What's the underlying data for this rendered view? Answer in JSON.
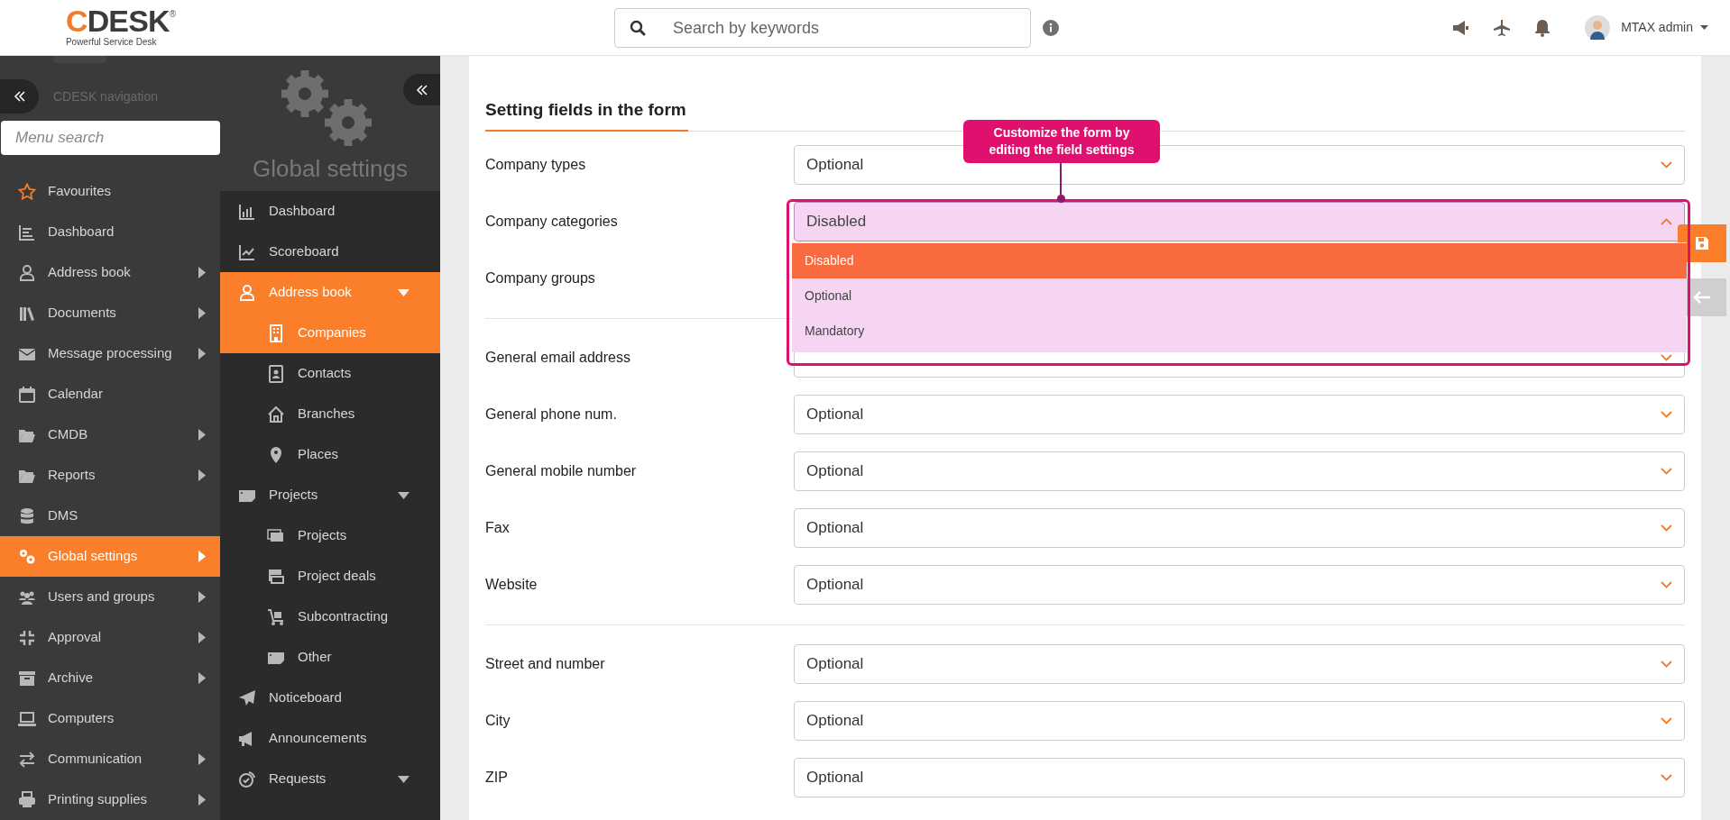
{
  "header": {
    "logo": {
      "name": "CDESK",
      "registered": "®",
      "tagline": "Powerful Service Desk"
    },
    "search": {
      "placeholder": "Search by keywords"
    },
    "user_name": "MTAX admin"
  },
  "navigation": {
    "title": "CDESK navigation",
    "search_placeholder": "Menu search",
    "items": [
      {
        "label": "Favourites",
        "has_submenu": false,
        "selected": false
      },
      {
        "label": "Dashboard",
        "has_submenu": false,
        "selected": false
      },
      {
        "label": "Address book",
        "has_submenu": true,
        "selected": false
      },
      {
        "label": "Documents",
        "has_submenu": true,
        "selected": false
      },
      {
        "label": "Message processing",
        "has_submenu": true,
        "selected": false
      },
      {
        "label": "Calendar",
        "has_submenu": false,
        "selected": false
      },
      {
        "label": "CMDB",
        "has_submenu": true,
        "selected": false
      },
      {
        "label": "Reports",
        "has_submenu": true,
        "selected": false
      },
      {
        "label": "DMS",
        "has_submenu": false,
        "selected": false
      },
      {
        "label": "Global settings",
        "has_submenu": true,
        "selected": true
      },
      {
        "label": "Users and groups",
        "has_submenu": true,
        "selected": false
      },
      {
        "label": "Approval",
        "has_submenu": true,
        "selected": false
      },
      {
        "label": "Archive",
        "has_submenu": true,
        "selected": false
      },
      {
        "label": "Computers",
        "has_submenu": false,
        "selected": false
      },
      {
        "label": "Communication",
        "has_submenu": true,
        "selected": false
      },
      {
        "label": "Printing supplies",
        "has_submenu": true,
        "selected": false
      }
    ]
  },
  "settings_panel": {
    "title": "Global settings",
    "items": [
      {
        "label": "Dashboard",
        "selected": false
      },
      {
        "label": "Scoreboard",
        "selected": false
      },
      {
        "label": "Address book",
        "selected": true,
        "expanded": true,
        "children": [
          {
            "label": "Companies",
            "selected": true
          },
          {
            "label": "Contacts",
            "selected": false
          },
          {
            "label": "Branches",
            "selected": false
          },
          {
            "label": "Places",
            "selected": false
          }
        ]
      },
      {
        "label": "Projects",
        "selected": false,
        "expanded": true,
        "children": [
          {
            "label": "Projects",
            "selected": false
          },
          {
            "label": "Project deals",
            "selected": false
          },
          {
            "label": "Subcontracting",
            "selected": false
          },
          {
            "label": "Other",
            "selected": false
          }
        ]
      },
      {
        "label": "Noticeboard",
        "selected": false
      },
      {
        "label": "Announcements",
        "selected": false
      },
      {
        "label": "Requests",
        "selected": false,
        "expanded": true
      }
    ]
  },
  "form": {
    "title": "Setting fields in the form",
    "groups": [
      [
        {
          "label": "Company types",
          "kind": "select",
          "value": "Optional"
        },
        {
          "label": "Company categories",
          "kind": "select",
          "value": "Disabled",
          "open": true,
          "options": [
            {
              "label": "Disabled",
              "selected": true
            },
            {
              "label": "Optional",
              "selected": false
            },
            {
              "label": "Mandatory",
              "selected": false
            }
          ]
        },
        {
          "label": "Company groups",
          "kind": "label_only"
        }
      ],
      [
        {
          "label": "General email address",
          "kind": "select"
        },
        {
          "label": "General phone num.",
          "kind": "select",
          "value": "Optional"
        },
        {
          "label": "General mobile number",
          "kind": "select",
          "value": "Optional"
        },
        {
          "label": "Fax",
          "kind": "select",
          "value": "Optional"
        },
        {
          "label": "Website",
          "kind": "select",
          "value": "Optional"
        }
      ],
      [
        {
          "label": "Street and number",
          "kind": "select",
          "value": "Optional"
        },
        {
          "label": "City",
          "kind": "select",
          "value": "Optional"
        },
        {
          "label": "ZIP",
          "kind": "select",
          "value": "Optional"
        }
      ]
    ],
    "tooltip": "Customize the form by editing the field settings"
  }
}
